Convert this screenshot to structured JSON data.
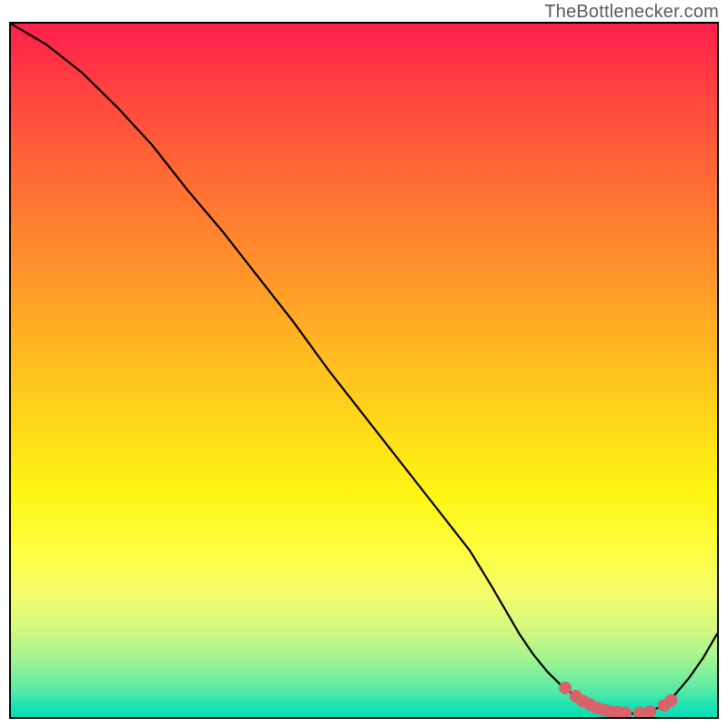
{
  "attribution": "TheBottlenecker.com",
  "chart_data": {
    "type": "line",
    "title": "",
    "xlabel": "",
    "ylabel": "",
    "xlim": [
      0,
      100
    ],
    "ylim": [
      0,
      100
    ],
    "series": [
      {
        "name": "curve",
        "x": [
          0,
          5,
          10,
          15,
          20,
          25,
          30,
          35,
          40,
          45,
          50,
          55,
          60,
          65,
          68,
          70,
          72,
          74,
          76,
          78,
          80,
          82,
          84,
          86,
          88,
          90,
          92,
          94,
          96,
          98,
          100
        ],
        "y": [
          100,
          97,
          93,
          88,
          82.5,
          76,
          70,
          63.5,
          57,
          50,
          43.5,
          37,
          30.5,
          24,
          19,
          15.5,
          12,
          9,
          6.5,
          4.5,
          3,
          2,
          1.3,
          0.8,
          0.5,
          0.6,
          1.5,
          3.2,
          5.6,
          8.5,
          12
        ]
      }
    ],
    "markers": {
      "name": "highlighted-points",
      "color": "#d9626b",
      "x": [
        78.5,
        80,
        81,
        82,
        83,
        84,
        85,
        86,
        87,
        89,
        90.5,
        92.5,
        93.5
      ],
      "y": [
        4.2,
        3.0,
        2.3,
        1.8,
        1.3,
        1.0,
        0.8,
        0.7,
        0.6,
        0.6,
        0.8,
        1.7,
        2.4
      ]
    },
    "background_gradient": [
      "#ff1e4c",
      "#ffb522",
      "#fff514",
      "#06deb6"
    ]
  }
}
